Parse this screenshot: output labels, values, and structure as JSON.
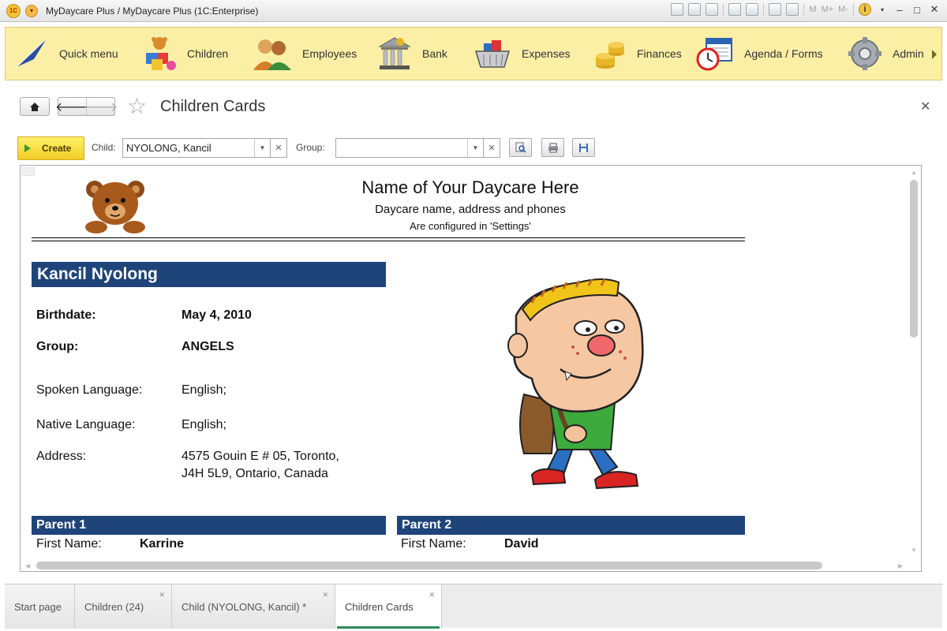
{
  "window": {
    "title": "MyDaycare Plus / MyDaycare Plus  (1C:Enterprise)",
    "toolbar_text": [
      "M",
      "M+",
      "M-"
    ]
  },
  "sections": [
    {
      "label": "Quick menu",
      "icon": "quick-menu-icon"
    },
    {
      "label": "Children",
      "icon": "children-icon"
    },
    {
      "label": "Employees",
      "icon": "employees-icon"
    },
    {
      "label": "Bank",
      "icon": "bank-icon"
    },
    {
      "label": "Expenses",
      "icon": "expenses-icon"
    },
    {
      "label": "Finances",
      "icon": "finances-icon"
    },
    {
      "label": "Agenda / Forms",
      "icon": "agenda-forms-icon"
    },
    {
      "label": "Admin",
      "icon": "admin-icon"
    }
  ],
  "form": {
    "title": "Children Cards",
    "create_label": "Create",
    "child_label": "Child:",
    "child_value": "NYOLONG, Kancil",
    "group_label": "Group:",
    "group_value": ""
  },
  "report": {
    "org_name": "Name of Your Daycare Here",
    "org_subtitle": "Daycare name, address and phones",
    "org_note": "Are configured in 'Settings'",
    "child_name": "Kancil Nyolong",
    "fields": {
      "birthdate_label": "Birthdate:",
      "birthdate_value": "May 4, 2010",
      "group_label": "Group:",
      "group_value": "ANGELS",
      "spoken_label": "Spoken Language:",
      "spoken_value": "English;",
      "native_label": "Native Language:",
      "native_value": "English;",
      "address_label": "Address:",
      "address_line1": "4575 Gouin E # 05, Toronto,",
      "address_line2": "J4H 5L9, Ontario, Canada"
    },
    "parent1": {
      "header": "Parent 1",
      "first_name_label": "First Name:",
      "first_name_value": "Karrine"
    },
    "parent2": {
      "header": "Parent 2",
      "first_name_label": "First Name:",
      "first_name_value": "David"
    }
  },
  "tabs": [
    {
      "label": "Start page",
      "closable": false
    },
    {
      "label": "Children (24)",
      "closable": true
    },
    {
      "label": "Child (NYOLONG, Kancil) *",
      "closable": true
    },
    {
      "label": "Children Cards",
      "closable": true,
      "active": true
    }
  ],
  "colors": {
    "section_bar": "#fbefa6",
    "header_blue": "#1f4479",
    "create_button": "#f6d936",
    "active_tab_underline": "#2e8b57"
  }
}
